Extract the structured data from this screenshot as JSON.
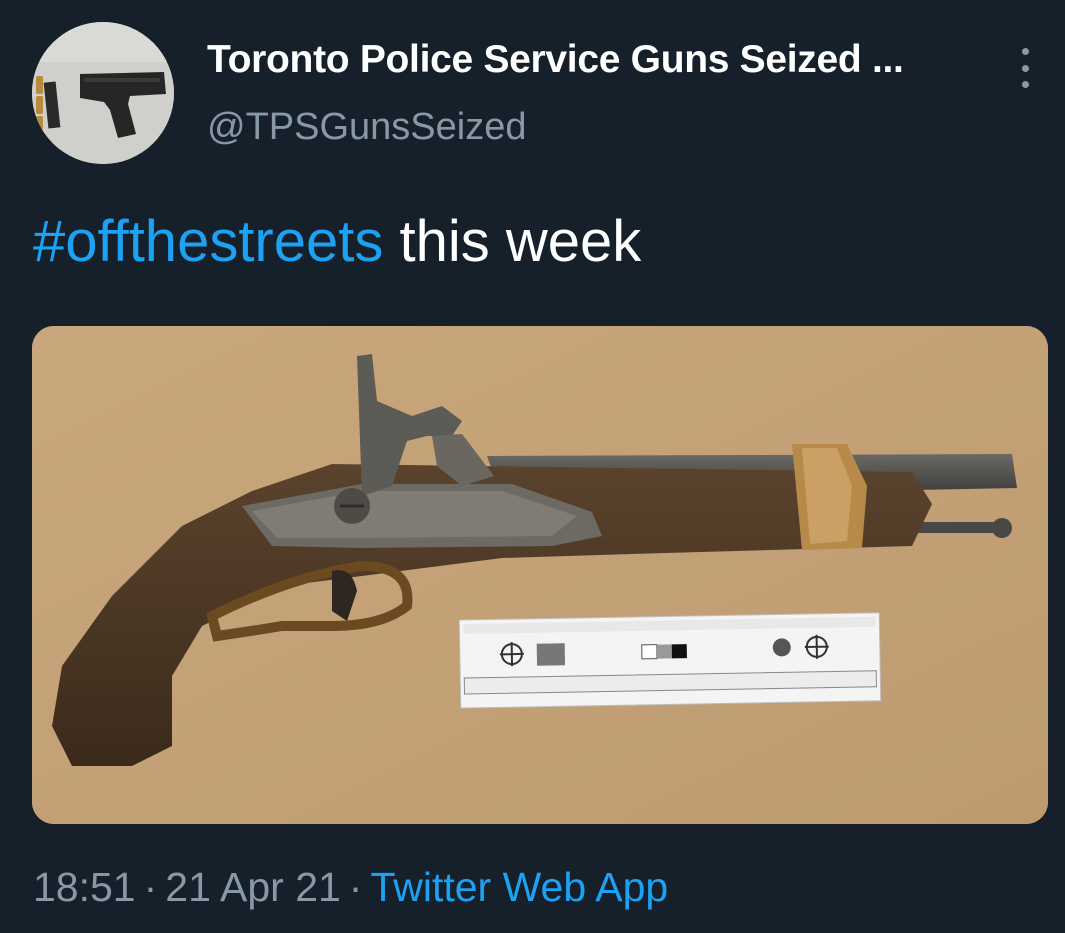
{
  "author": {
    "display_name": "Toronto Police Service Guns Seized ...",
    "handle": "@TPSGunsSeized"
  },
  "tweet": {
    "hashtag": "#offthestreets",
    "text": " this week"
  },
  "meta": {
    "time": "18:51",
    "separator": "·",
    "date": "21 Apr 21",
    "source": "Twitter Web App"
  },
  "colors": {
    "background": "#15202b",
    "accent": "#1da1f2",
    "secondary_text": "#8899a6"
  },
  "icons": {
    "more": "more-vertical-icon"
  }
}
